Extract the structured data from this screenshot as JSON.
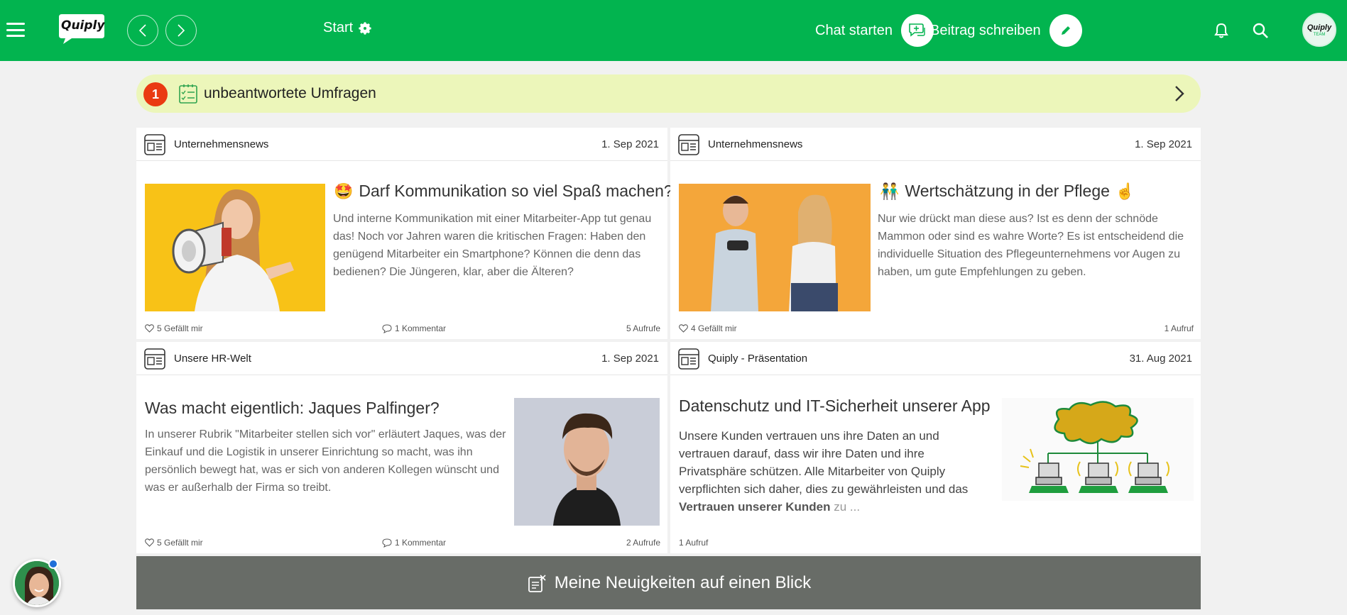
{
  "header": {
    "logo_text": "Quiply",
    "start_label": "Start",
    "chat_label": "Chat starten",
    "write_label": "Beitrag schreiben",
    "avatar_text": "Quiply",
    "avatar_sub": "TEAM",
    "brand_color": "#02b44f"
  },
  "survey": {
    "count": "1",
    "label": "unbeantwortete Umfragen"
  },
  "posts": [
    {
      "category": "Unternehmensnews",
      "date": "1. Sep 2021",
      "emoji_before": "🤩",
      "title": "Darf Kommunikation so viel Spaß machen?",
      "emoji_after": "👏",
      "body": "Und interne Kommunikation mit einer Mitarbeiter-App tut genau das! Noch vor Jahren waren die kritischen Fragen: Haben den genügend Mitarbeiter ein Smartphone? Können die denn das bedienen? Die Jüngeren, klar, aber die Älteren?",
      "likes": "5 Gefällt mir",
      "comments": "1 Kommentar",
      "views": "5 Aufrufe"
    },
    {
      "category": "Unternehmensnews",
      "date": "1. Sep 2021",
      "emoji_before": "👬",
      "title": "Wertschätzung in der Pflege",
      "emoji_after": "☝️",
      "body": "Nur wie drückt man diese aus? Ist es denn der schnöde Mammon oder sind es wahre Worte? Es ist entscheidend die individuelle Situation des Pflegeunternehmens vor Augen zu haben, um gute Empfehlungen zu geben.",
      "likes": "4 Gefällt mir",
      "views": "1 Aufruf"
    },
    {
      "category": "Unsere HR-Welt",
      "date": "1. Sep 2021",
      "title": "Was macht eigentlich: Jaques Palfinger?",
      "body": "In unserer Rubrik \"Mitarbeiter stellen sich vor\" erläutert Jaques, was der Einkauf und die Logistik in unserer Einrichtung so macht, was ihn persönlich bewegt hat, was er sich von anderen Kollegen wünscht und was er außerhalb der Firma so treibt.",
      "likes": "5 Gefällt mir",
      "comments": "1 Kommentar",
      "views": "2 Aufrufe"
    },
    {
      "category": "Quiply - Präsentation",
      "date": "31. Aug 2021",
      "title": "Datenschutz und IT-Sicherheit unserer App",
      "body_start": "Unsere Kunden vertrauen uns ihre Daten an und vertrauen darauf, dass wir ihre Daten und ihre Privatsphäre schützen. Alle Mitarbeiter von Quiply verpflichten sich daher, dies zu gewährleisten und das ",
      "body_bold": "Vertrauen unserer Kunden",
      "body_end": " zu  ...",
      "views": "1 Aufruf"
    }
  ],
  "news_bar": {
    "label": "Meine Neuigkeiten auf einen Blick"
  }
}
